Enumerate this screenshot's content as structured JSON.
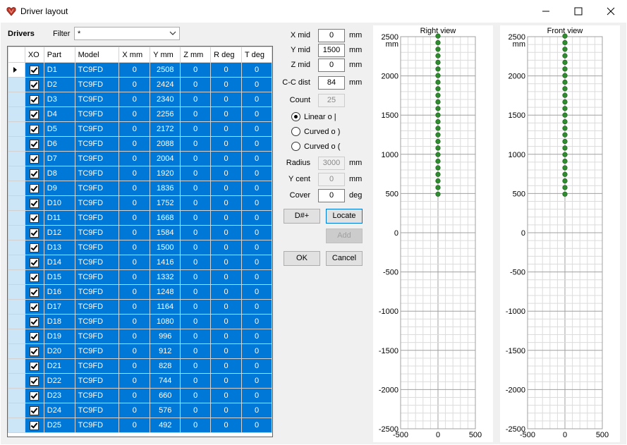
{
  "window": {
    "title": "Driver layout",
    "minimize_icon": "minimize-icon",
    "maximize_icon": "maximize-icon",
    "close_icon": "close-icon"
  },
  "drivers": {
    "label": "Drivers",
    "filter_label": "Filter",
    "filter_value": "*",
    "columns": [
      "XO",
      "Part",
      "Model",
      "X mm",
      "Y mm",
      "Z mm",
      "R deg",
      "T deg"
    ],
    "rows": [
      {
        "part": "D1",
        "model": "TC9FD",
        "x": "0",
        "y": "2508",
        "z": "0",
        "r": "0",
        "t": "0"
      },
      {
        "part": "D2",
        "model": "TC9FD",
        "x": "0",
        "y": "2424",
        "z": "0",
        "r": "0",
        "t": "0"
      },
      {
        "part": "D3",
        "model": "TC9FD",
        "x": "0",
        "y": "2340",
        "z": "0",
        "r": "0",
        "t": "0"
      },
      {
        "part": "D4",
        "model": "TC9FD",
        "x": "0",
        "y": "2256",
        "z": "0",
        "r": "0",
        "t": "0"
      },
      {
        "part": "D5",
        "model": "TC9FD",
        "x": "0",
        "y": "2172",
        "z": "0",
        "r": "0",
        "t": "0"
      },
      {
        "part": "D6",
        "model": "TC9FD",
        "x": "0",
        "y": "2088",
        "z": "0",
        "r": "0",
        "t": "0"
      },
      {
        "part": "D7",
        "model": "TC9FD",
        "x": "0",
        "y": "2004",
        "z": "0",
        "r": "0",
        "t": "0"
      },
      {
        "part": "D8",
        "model": "TC9FD",
        "x": "0",
        "y": "1920",
        "z": "0",
        "r": "0",
        "t": "0"
      },
      {
        "part": "D9",
        "model": "TC9FD",
        "x": "0",
        "y": "1836",
        "z": "0",
        "r": "0",
        "t": "0"
      },
      {
        "part": "D10",
        "model": "TC9FD",
        "x": "0",
        "y": "1752",
        "z": "0",
        "r": "0",
        "t": "0"
      },
      {
        "part": "D11",
        "model": "TC9FD",
        "x": "0",
        "y": "1668",
        "z": "0",
        "r": "0",
        "t": "0"
      },
      {
        "part": "D12",
        "model": "TC9FD",
        "x": "0",
        "y": "1584",
        "z": "0",
        "r": "0",
        "t": "0"
      },
      {
        "part": "D13",
        "model": "TC9FD",
        "x": "0",
        "y": "1500",
        "z": "0",
        "r": "0",
        "t": "0"
      },
      {
        "part": "D14",
        "model": "TC9FD",
        "x": "0",
        "y": "1416",
        "z": "0",
        "r": "0",
        "t": "0"
      },
      {
        "part": "D15",
        "model": "TC9FD",
        "x": "0",
        "y": "1332",
        "z": "0",
        "r": "0",
        "t": "0"
      },
      {
        "part": "D16",
        "model": "TC9FD",
        "x": "0",
        "y": "1248",
        "z": "0",
        "r": "0",
        "t": "0"
      },
      {
        "part": "D17",
        "model": "TC9FD",
        "x": "0",
        "y": "1164",
        "z": "0",
        "r": "0",
        "t": "0"
      },
      {
        "part": "D18",
        "model": "TC9FD",
        "x": "0",
        "y": "1080",
        "z": "0",
        "r": "0",
        "t": "0"
      },
      {
        "part": "D19",
        "model": "TC9FD",
        "x": "0",
        "y": "996",
        "z": "0",
        "r": "0",
        "t": "0"
      },
      {
        "part": "D20",
        "model": "TC9FD",
        "x": "0",
        "y": "912",
        "z": "0",
        "r": "0",
        "t": "0"
      },
      {
        "part": "D21",
        "model": "TC9FD",
        "x": "0",
        "y": "828",
        "z": "0",
        "r": "0",
        "t": "0"
      },
      {
        "part": "D22",
        "model": "TC9FD",
        "x": "0",
        "y": "744",
        "z": "0",
        "r": "0",
        "t": "0"
      },
      {
        "part": "D23",
        "model": "TC9FD",
        "x": "0",
        "y": "660",
        "z": "0",
        "r": "0",
        "t": "0"
      },
      {
        "part": "D24",
        "model": "TC9FD",
        "x": "0",
        "y": "576",
        "z": "0",
        "r": "0",
        "t": "0"
      },
      {
        "part": "D25",
        "model": "TC9FD",
        "x": "0",
        "y": "492",
        "z": "0",
        "r": "0",
        "t": "0"
      }
    ]
  },
  "params": {
    "xmid": {
      "label": "X mid",
      "value": "0",
      "unit": "mm"
    },
    "ymid": {
      "label": "Y mid",
      "value": "1500",
      "unit": "mm"
    },
    "zmid": {
      "label": "Z mid",
      "value": "0",
      "unit": "mm"
    },
    "ccdist": {
      "label": "C-C dist",
      "value": "84",
      "unit": "mm"
    },
    "count": {
      "label": "Count",
      "value": "25"
    },
    "linear": "Linear  o  |",
    "curved1": "Curved  o  )",
    "curved2": "Curved  o  (",
    "radius": {
      "label": "Radius",
      "value": "3000",
      "unit": "mm"
    },
    "ycent": {
      "label": "Y cent",
      "value": "0",
      "unit": "mm"
    },
    "cover": {
      "label": "Cover",
      "value": "0",
      "unit": "deg"
    }
  },
  "buttons": {
    "dnum": "D#+",
    "locate": "Locate",
    "add": "Add",
    "ok": "OK",
    "cancel": "Cancel"
  },
  "colors": {
    "selection": "#0078d7",
    "point": "#2e8b2e",
    "accent": "#c0392b"
  },
  "views": [
    {
      "title": "Right view",
      "unit": "mm",
      "xticks": [
        "-500",
        "0",
        "500"
      ],
      "yticks": [
        "2500",
        "2000",
        "1500",
        "1000",
        "500",
        "0",
        "-500",
        "-1000",
        "-1500",
        "-2000",
        "-2500"
      ]
    },
    {
      "title": "Front view",
      "unit": "mm",
      "xticks": [
        "-500",
        "0",
        "500"
      ],
      "yticks": [
        "2500",
        "2000",
        "1500",
        "1000",
        "500",
        "0",
        "-500",
        "-1000",
        "-1500",
        "-2000",
        "-2500"
      ]
    }
  ],
  "chart_data": [
    {
      "type": "scatter",
      "title": "Right view",
      "xlim": [
        -500,
        500
      ],
      "ylim": [
        -2500,
        2500
      ],
      "grid": true,
      "series": [
        {
          "values": [
            [
              0,
              2508
            ],
            [
              0,
              2424
            ],
            [
              0,
              2340
            ],
            [
              0,
              2256
            ],
            [
              0,
              2172
            ],
            [
              0,
              2088
            ],
            [
              0,
              2004
            ],
            [
              0,
              1920
            ],
            [
              0,
              1836
            ],
            [
              0,
              1752
            ],
            [
              0,
              1668
            ],
            [
              0,
              1584
            ],
            [
              0,
              1500
            ],
            [
              0,
              1416
            ],
            [
              0,
              1332
            ],
            [
              0,
              1248
            ],
            [
              0,
              1164
            ],
            [
              0,
              1080
            ],
            [
              0,
              996
            ],
            [
              0,
              912
            ],
            [
              0,
              828
            ],
            [
              0,
              744
            ],
            [
              0,
              660
            ],
            [
              0,
              576
            ],
            [
              0,
              492
            ]
          ]
        }
      ]
    },
    {
      "type": "scatter",
      "title": "Front view",
      "xlim": [
        -500,
        500
      ],
      "ylim": [
        -2500,
        2500
      ],
      "grid": true,
      "series": [
        {
          "values": [
            [
              0,
              2508
            ],
            [
              0,
              2424
            ],
            [
              0,
              2340
            ],
            [
              0,
              2256
            ],
            [
              0,
              2172
            ],
            [
              0,
              2088
            ],
            [
              0,
              2004
            ],
            [
              0,
              1920
            ],
            [
              0,
              1836
            ],
            [
              0,
              1752
            ],
            [
              0,
              1668
            ],
            [
              0,
              1584
            ],
            [
              0,
              1500
            ],
            [
              0,
              1416
            ],
            [
              0,
              1332
            ],
            [
              0,
              1248
            ],
            [
              0,
              1164
            ],
            [
              0,
              1080
            ],
            [
              0,
              996
            ],
            [
              0,
              912
            ],
            [
              0,
              828
            ],
            [
              0,
              744
            ],
            [
              0,
              660
            ],
            [
              0,
              576
            ],
            [
              0,
              492
            ]
          ]
        }
      ]
    }
  ]
}
